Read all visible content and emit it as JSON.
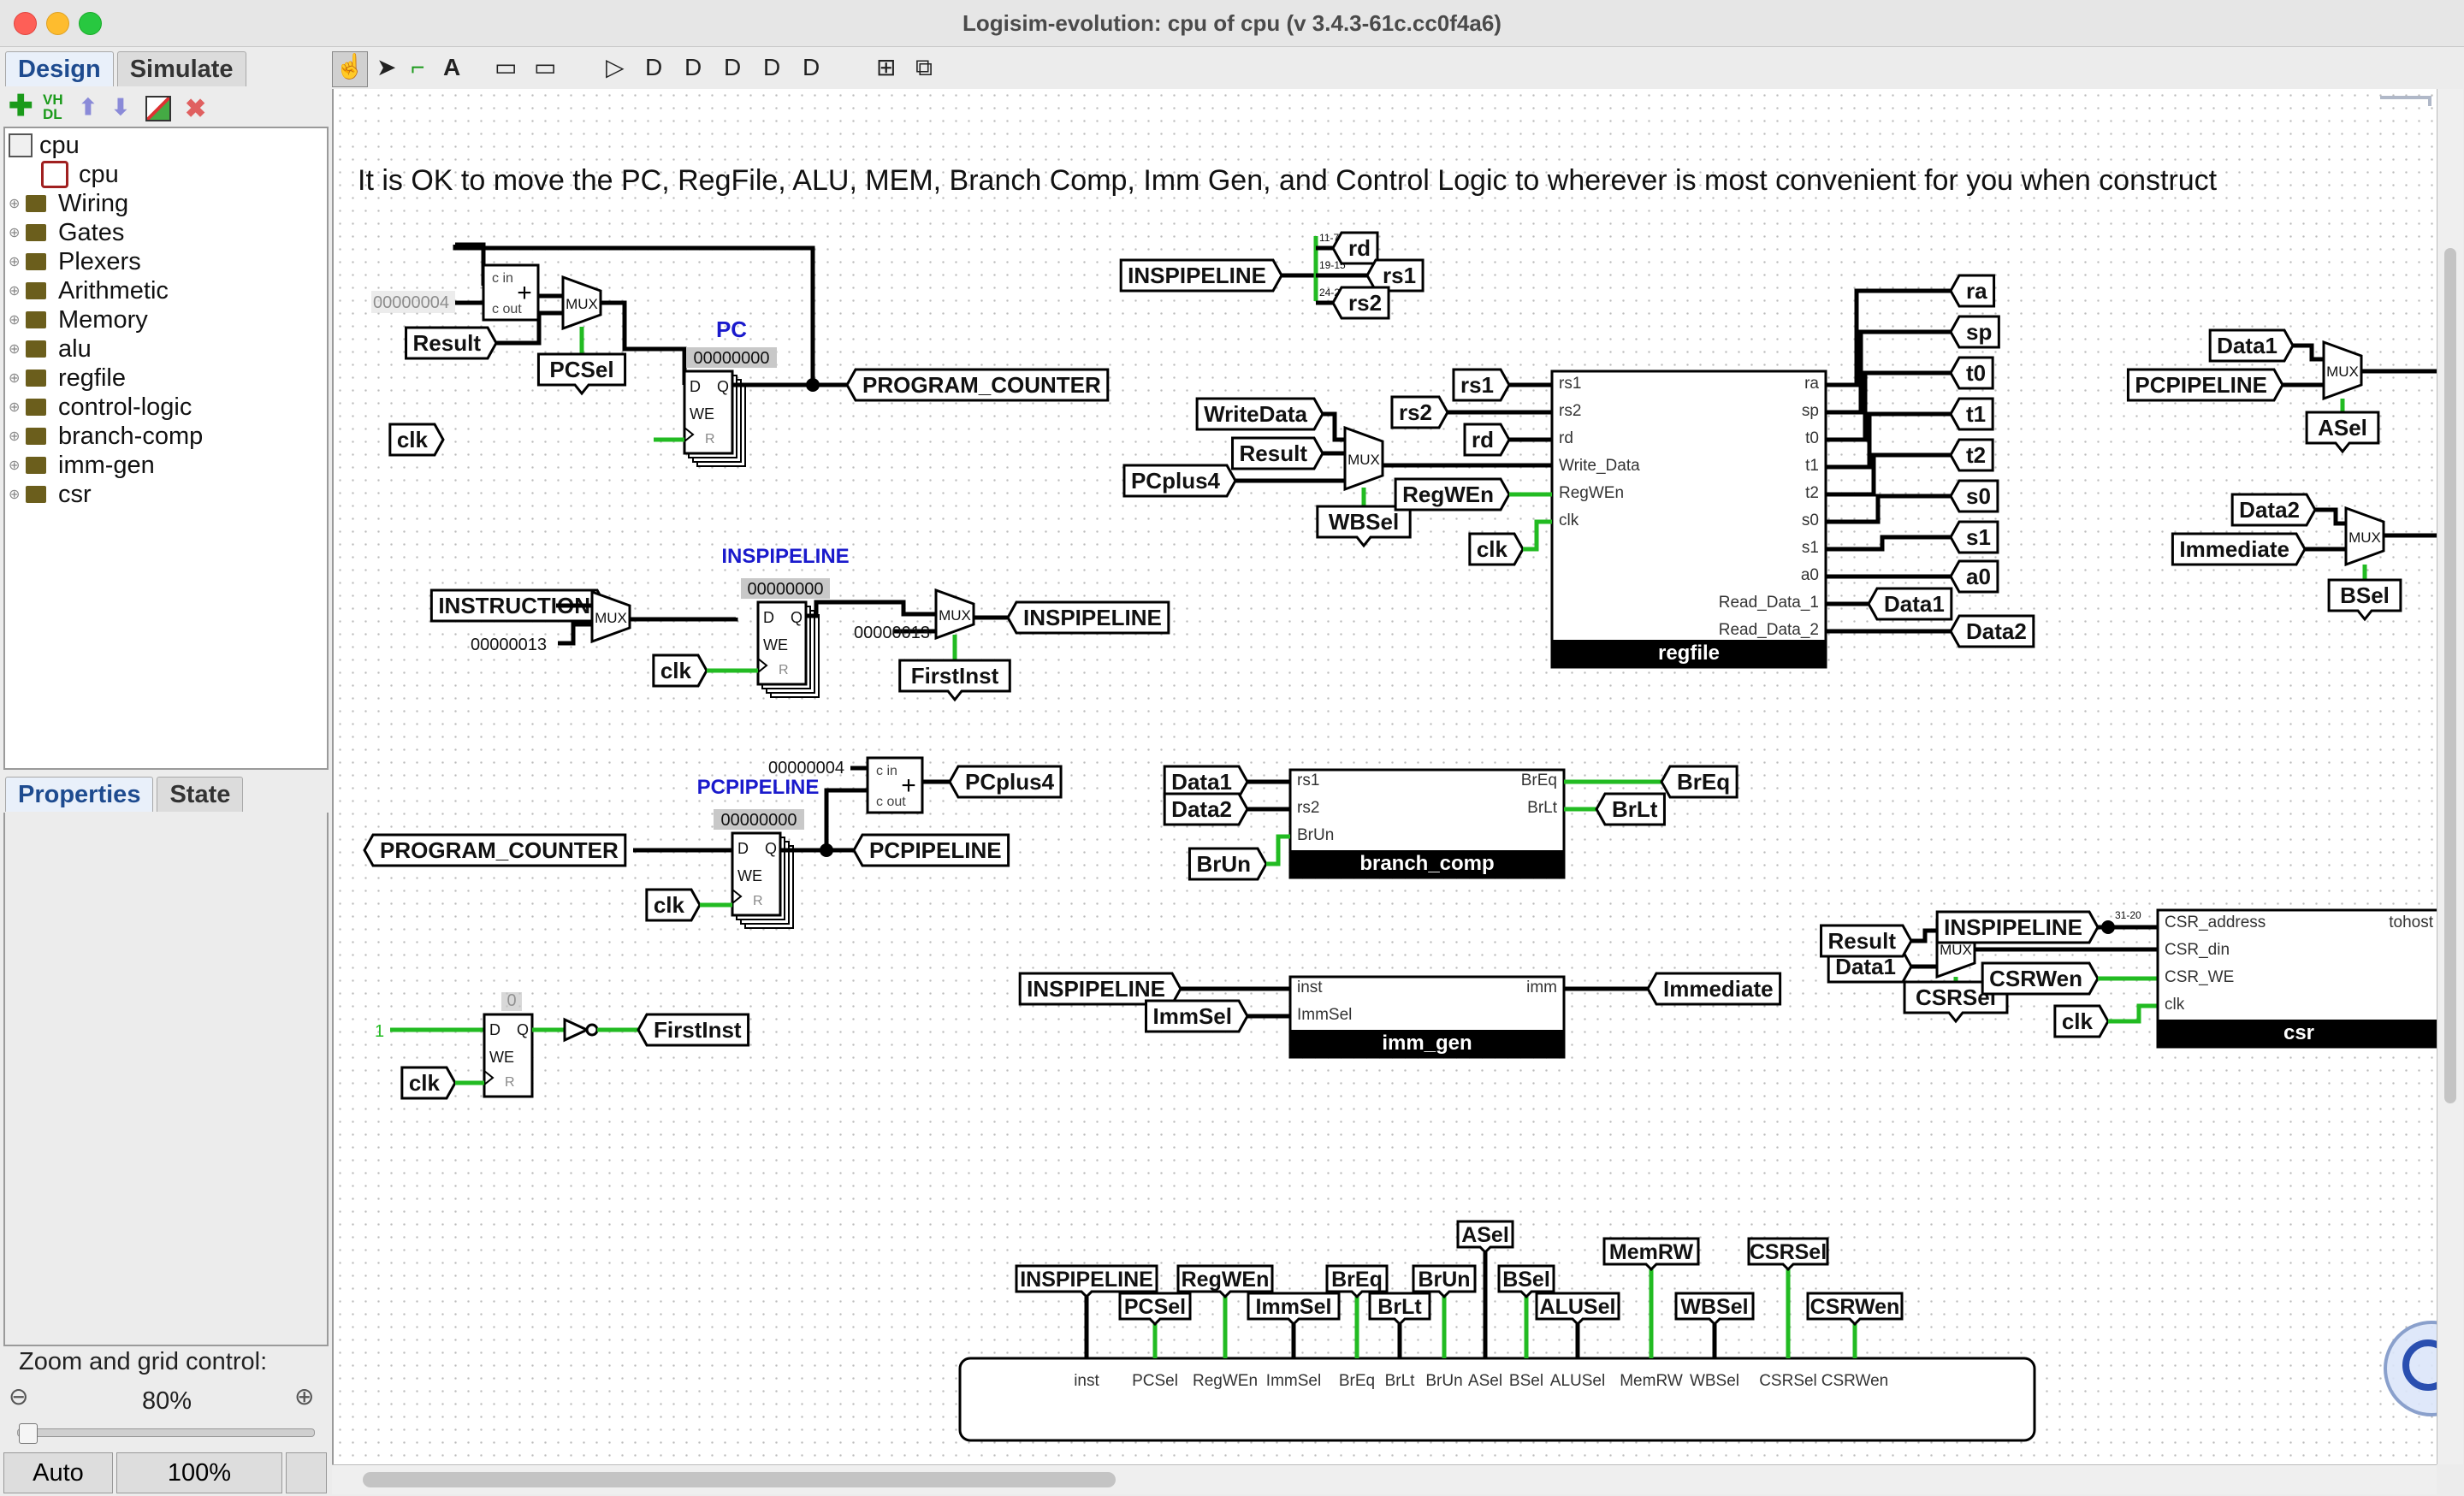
{
  "window": {
    "title": "Logisim-evolution: cpu of cpu (v 3.4.3-61c.cc0f4a6)"
  },
  "left_tabs": [
    "Design",
    "Simulate"
  ],
  "left_toolbar": {
    "vhdl_label": "VH\nDL"
  },
  "tree": {
    "root": "cpu",
    "circuit": "cpu",
    "folders": [
      "Wiring",
      "Gates",
      "Plexers",
      "Arithmetic",
      "Memory",
      "alu",
      "regfile",
      "control-logic",
      "branch-comp",
      "imm-gen",
      "csr"
    ]
  },
  "prop_tabs": [
    "Properties",
    "State"
  ],
  "zoom": {
    "title": "Zoom and grid control:",
    "value": "80%",
    "auto": "Auto",
    "hundred": "100%"
  },
  "canvas": {
    "note": "It is OK to move the PC, RegFile, ALU, MEM, Branch Comp, Imm Gen, and Control Logic to wherever is most convenient for you when construct",
    "pc": {
      "label": "PC",
      "value": "00000000",
      "const4": "00000004"
    },
    "tunnels": {
      "result": "Result",
      "pcsel": "PCSel",
      "clk": "clk",
      "program_counter": "PROGRAM_COUNTER",
      "instruction": "INSTRUCTION",
      "inspipeline": "INSPIPELINE",
      "firstinst": "FirstInst",
      "pcplus4": "PCplus4",
      "pcpipeline": "PCPIPELINE",
      "writedata": "WriteData",
      "wbsel": "WBSel",
      "regwen": "RegWEn",
      "rs1": "rs1",
      "rs2": "rs2",
      "rd": "rd",
      "data1": "Data1",
      "data2": "Data2",
      "asel": "ASel",
      "bsel": "BSel",
      "immediate": "Immediate",
      "brun": "BrUn",
      "breq": "BrEq",
      "brlt": "BrLt",
      "immsel": "ImmSel",
      "csrwen": "CSRWen",
      "csrsel": "CSRSel",
      "alusel": "ALUSel",
      "memrw": "MemRW",
      "regs": [
        "ra",
        "sp",
        "t0",
        "t1",
        "t2",
        "s0",
        "s1",
        "a0"
      ]
    },
    "inspipe": {
      "label": "INSPIPELINE",
      "value": "00000000",
      "nop": "00000013"
    },
    "pcpipe": {
      "label": "PCPIPELINE",
      "value": "00000000",
      "const4": "00000004"
    },
    "firstinst_reg": {
      "value": "0",
      "one": "1"
    },
    "regfile": {
      "name": "regfile",
      "inputs": [
        "rs1",
        "rs2",
        "rd",
        "Write_Data",
        "RegWEn",
        "clk"
      ],
      "outputs": [
        "ra",
        "sp",
        "t0",
        "t1",
        "t2",
        "s0",
        "s1",
        "a0",
        "Read_Data_1",
        "Read_Data_2"
      ]
    },
    "branch_comp": {
      "name": "branch_comp",
      "inputs": [
        "rs1",
        "rs2",
        "BrUn"
      ],
      "outputs": [
        "BrEq",
        "BrLt"
      ]
    },
    "imm_gen": {
      "name": "imm_gen",
      "inputs": [
        "inst",
        "ImmSel"
      ],
      "output": "imm"
    },
    "csr": {
      "name": "csr",
      "inputs": [
        "CSR_address",
        "CSR_din",
        "CSR_WE",
        "clk"
      ],
      "output": "tohost",
      "bits": "31-20"
    },
    "control": {
      "ports": [
        "inst",
        "PCSel",
        "RegWEn",
        "ImmSel",
        "BrEq",
        "BrLt",
        "BrUn",
        "ASel",
        "BSel",
        "ALUSel",
        "MemRW",
        "WBSel",
        "CSRSel",
        "CSRWen"
      ]
    },
    "mux_label": "MUX",
    "adder": {
      "cin": "c in",
      "cout": "c out"
    },
    "reg_ports": {
      "d": "D",
      "q": "Q",
      "we": "WE",
      "r": "R"
    },
    "splitter_bits": [
      "11-7",
      "19-15",
      "24-20"
    ]
  },
  "colors": {
    "wire": "#000000",
    "active_wire": "#22bb22",
    "label_blue": "#1a1acc",
    "value_bg": "#c8c8c8",
    "comp_label_bg": "#000000"
  }
}
